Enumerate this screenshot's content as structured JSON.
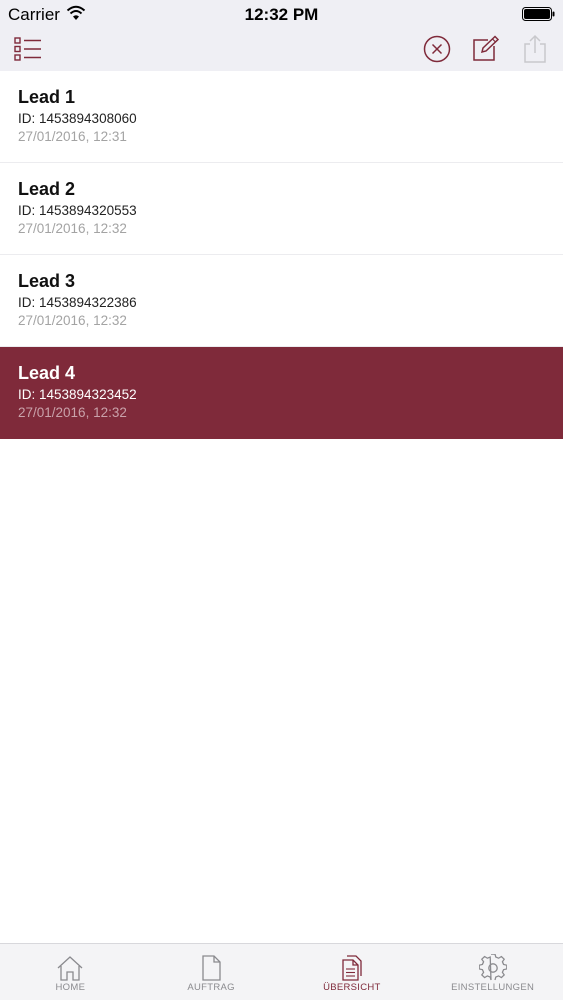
{
  "status_bar": {
    "carrier": "Carrier",
    "time": "12:32 PM"
  },
  "nav_bar": {
    "left_icon": "list-icon",
    "right_icons": [
      "close-circle-icon",
      "edit-icon",
      "share-icon"
    ]
  },
  "leads": [
    {
      "title": "Lead 1",
      "id": "ID: 1453894308060",
      "date": "27/01/2016, 12:31",
      "selected": false
    },
    {
      "title": "Lead 2",
      "id": "ID: 1453894320553",
      "date": "27/01/2016, 12:32",
      "selected": false
    },
    {
      "title": "Lead 3",
      "id": "ID: 1453894322386",
      "date": "27/01/2016, 12:32",
      "selected": false
    },
    {
      "title": "Lead 4",
      "id": "ID: 1453894323452",
      "date": "27/01/2016, 12:32",
      "selected": true
    }
  ],
  "tab_bar": {
    "tabs": [
      {
        "label": "HOME",
        "icon": "home-icon",
        "active": false
      },
      {
        "label": "AUFTRAG",
        "icon": "document-icon",
        "active": false
      },
      {
        "label": "ÜBERSICHT",
        "icon": "documents-icon",
        "active": true
      },
      {
        "label": "EINSTELLUNGEN",
        "icon": "gear-icon",
        "active": false
      }
    ]
  },
  "colors": {
    "accent": "#7f2a3a",
    "bar_background": "#efeff4",
    "inactive_tab": "#8a8a8e"
  }
}
